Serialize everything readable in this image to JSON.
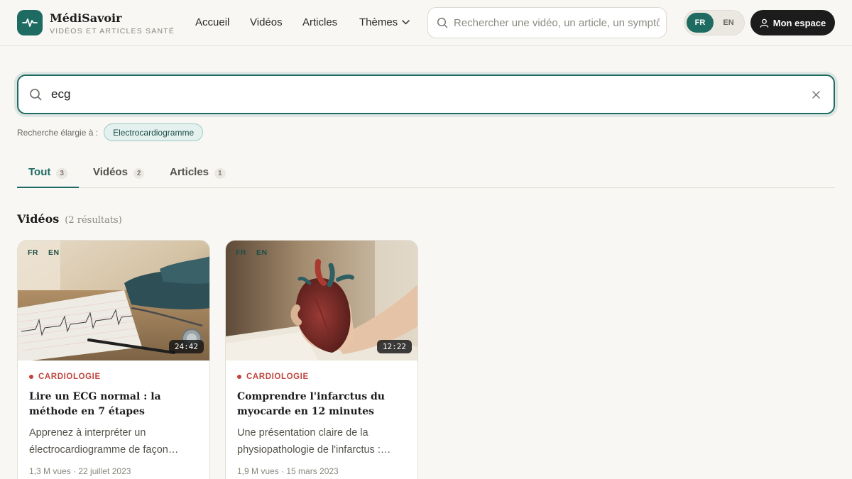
{
  "header": {
    "brand_name": "MédiSavoir",
    "brand_tagline": "VIDÉOS ET ARTICLES SANTÉ",
    "nav": {
      "home": "Accueil",
      "videos": "Vidéos",
      "articles": "Articles",
      "themes": "Thèmes"
    },
    "search_placeholder": "Rechercher une vidéo, un article, un symptôme",
    "lang": {
      "fr": "FR",
      "en": "EN",
      "active": "FR"
    },
    "account_label": "Mon espace"
  },
  "search": {
    "query": "ecg",
    "broadened_label": "Recherche élargie à :",
    "broadened_term": "Electrocardiogramme"
  },
  "tabs": [
    {
      "label": "Tout",
      "count": "3",
      "active": true
    },
    {
      "label": "Vidéos",
      "count": "2",
      "active": false
    },
    {
      "label": "Articles",
      "count": "1",
      "active": false
    }
  ],
  "videos_section": {
    "title": "Vidéos",
    "count_text": "(2 résultats)",
    "cards": [
      {
        "lang_fr": "FR",
        "lang_en": "EN",
        "duration": "24:42",
        "category": "CARDIOLOGIE",
        "title": "Lire un ECG normal : la méthode en 7 étapes",
        "description": "Apprenez à interpréter un électrocardiogramme de façon…",
        "meta": "1,3 M vues · 22 juillet 2023"
      },
      {
        "lang_fr": "FR",
        "lang_en": "EN",
        "duration": "12:22",
        "category": "CARDIOLOGIE",
        "title": "Comprendre l'infarctus du myocarde en 12 minutes",
        "description": "Une présentation claire de la physiopathologie de l'infarctus :…",
        "meta": "1,9 M vues · 15 mars 2023"
      }
    ]
  },
  "colors": {
    "brand": "#1d6b61",
    "accent_category": "#c0453f",
    "background": "#f8f7f4"
  }
}
